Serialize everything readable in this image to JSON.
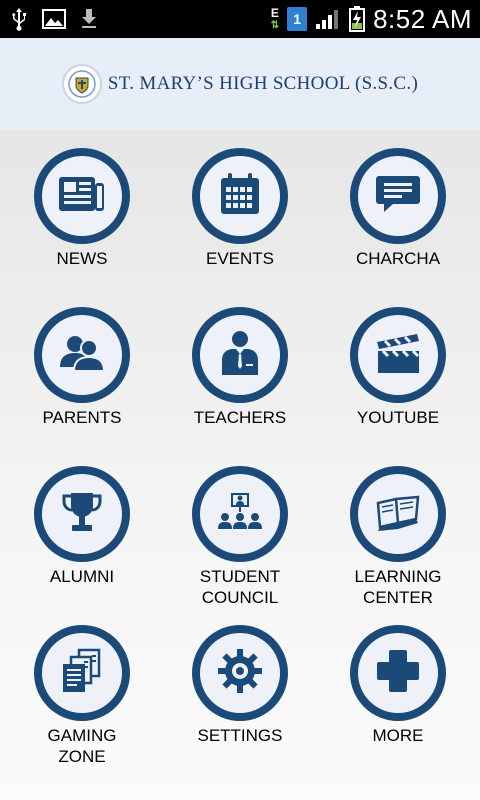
{
  "status_bar": {
    "time": "8:52 AM",
    "sim_label": "1",
    "network_type": "E",
    "icons": [
      "usb-icon",
      "image-icon",
      "download-icon",
      "data-arrows-icon",
      "sim-icon",
      "signal-icon",
      "battery-charging-icon"
    ]
  },
  "header": {
    "school_name": "ST. MARY’S HIGH SCHOOL (S.S.C.)",
    "logo": "school-crest-icon"
  },
  "colors": {
    "accent": "#1c4a78",
    "header_bg": "#e8eef7",
    "icon_fill": "#1c4a78"
  },
  "menu": [
    {
      "label": "NEWS",
      "icon": "newspaper-icon"
    },
    {
      "label": "EVENTS",
      "icon": "calendar-icon"
    },
    {
      "label": "CHARCHA",
      "icon": "chat-icon"
    },
    {
      "label": "PARENTS",
      "icon": "people-icon"
    },
    {
      "label": "TEACHERS",
      "icon": "teacher-icon"
    },
    {
      "label": "YOUTUBE",
      "icon": "clapperboard-icon"
    },
    {
      "label": "ALUMNI",
      "icon": "trophy-icon"
    },
    {
      "label": "STUDENT\nCOUNCIL",
      "icon": "council-icon"
    },
    {
      "label": "LEARNING\nCENTER",
      "icon": "book-icon"
    },
    {
      "label": "GAMING\nZONE",
      "icon": "documents-icon"
    },
    {
      "label": "SETTINGS",
      "icon": "gear-icon"
    },
    {
      "label": "MORE",
      "icon": "plus-icon"
    }
  ]
}
